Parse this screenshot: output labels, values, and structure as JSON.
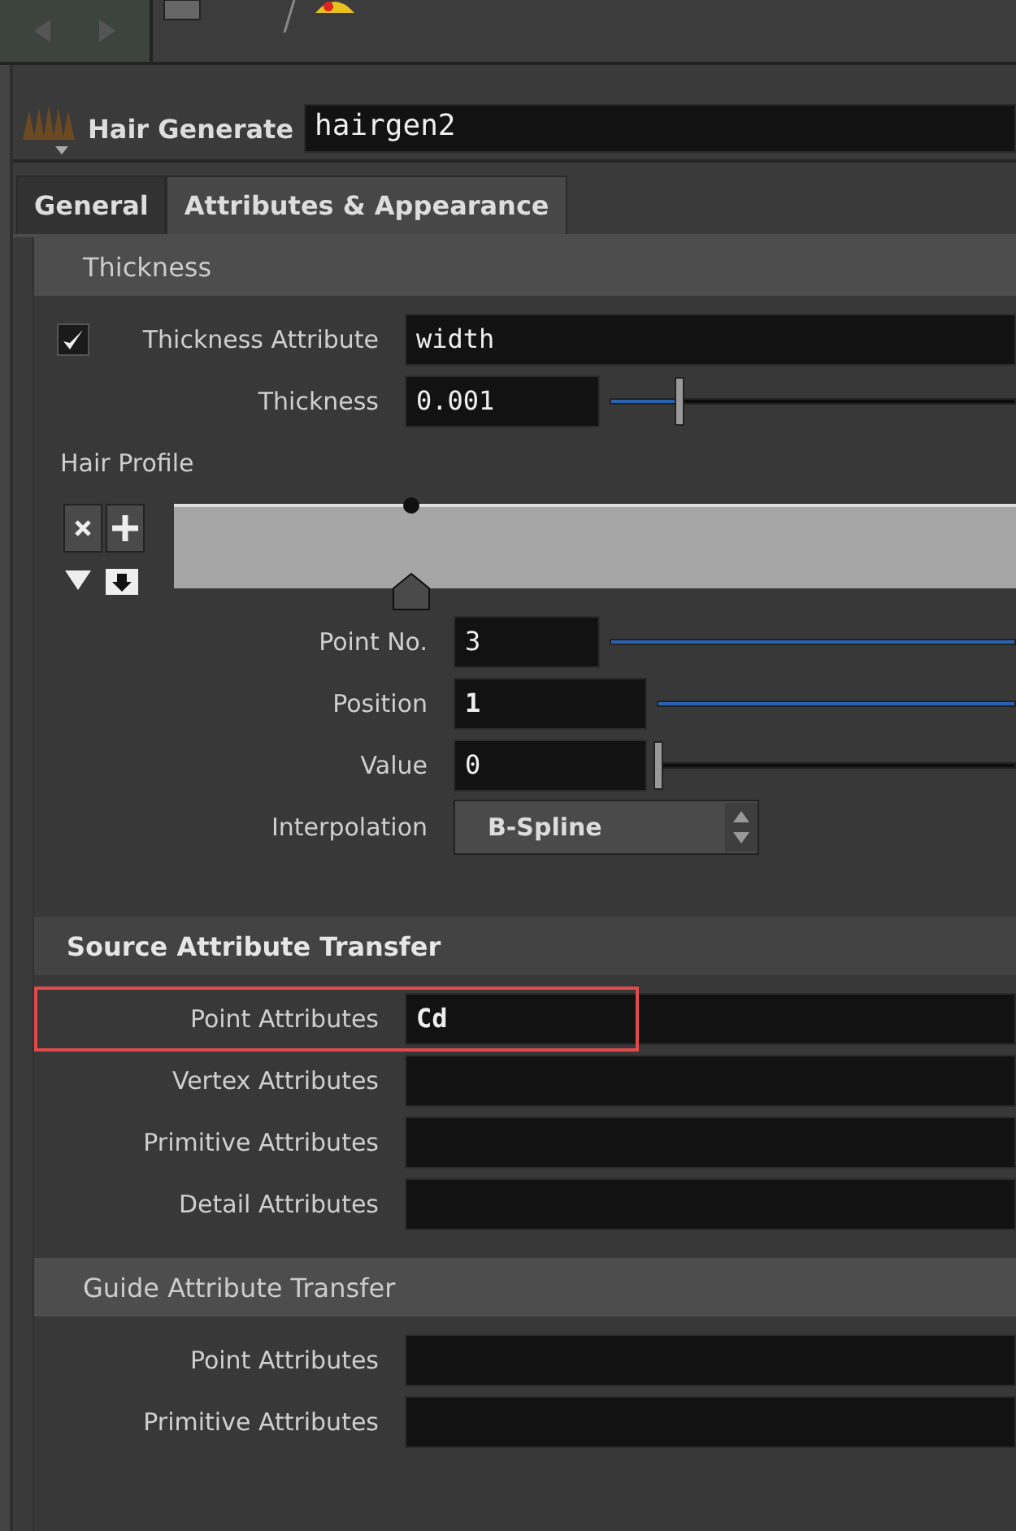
{
  "node": {
    "type_label": "Hair Generate",
    "name": "hairgen2"
  },
  "tabs": [
    {
      "label": "General",
      "selected": false
    },
    {
      "label": "Attributes & Appearance",
      "selected": true
    }
  ],
  "thickness_section": {
    "title": "Thickness",
    "attribute": {
      "label": "Thickness Attribute",
      "checked": true,
      "value": "width"
    },
    "thickness": {
      "label": "Thickness",
      "value": "0.001",
      "level": 0.17
    },
    "profile": {
      "label": "Hair Profile",
      "params": [
        {
          "kind": "slider",
          "label": "Point No.",
          "value": "3",
          "level": 1
        },
        {
          "kind": "slider",
          "label": "Position",
          "value": "1",
          "level": 1
        },
        {
          "kind": "slider",
          "label": "Value",
          "value": "0",
          "level": 0
        },
        {
          "kind": "menu",
          "label": "Interpolation",
          "value": "B-Spline"
        }
      ]
    }
  },
  "sections": [
    {
      "title": "Source Attribute Transfer",
      "emphasized": true,
      "rows": [
        {
          "label": "Point Attributes",
          "value": "Cd",
          "highlighted": true
        },
        {
          "label": "Vertex Attributes",
          "highlighted": false
        },
        {
          "label": "Primitive Attributes",
          "highlighted": false
        },
        {
          "label": "Detail Attributes",
          "highlighted": false
        }
      ]
    },
    {
      "title": "Guide Attribute Transfer",
      "emphasized": false,
      "rows": [
        {
          "label": "Point Attributes",
          "highlighted": false
        },
        {
          "label": "Primitive Attributes",
          "highlighted": false
        }
      ]
    }
  ]
}
